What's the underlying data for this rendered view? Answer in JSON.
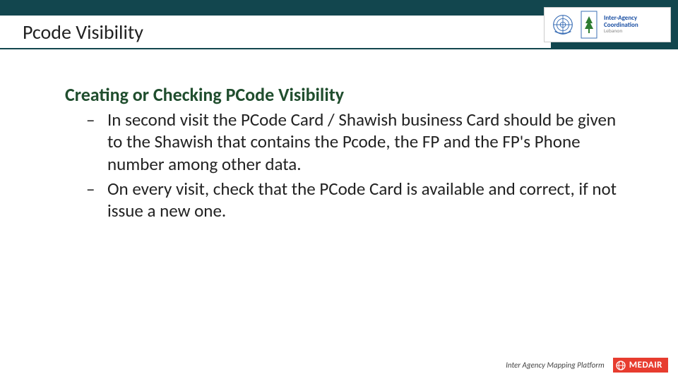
{
  "header": {
    "title": "Pcode Visibility",
    "logo": {
      "text_line1": "Inter-Agency",
      "text_line2": "Coordination",
      "text_line3": "Lebanon"
    }
  },
  "content": {
    "subtitle": "Creating  or Checking PCode Visibility",
    "bullets": [
      "In second visit the PCode Card / Shawish business Card should be given to the Shawish that contains the Pcode, the FP and the FP's Phone number among other data.",
      "On every visit, check that the PCode Card is available and correct, if not issue a new one."
    ]
  },
  "footer": {
    "caption": "Inter Agency Mapping Platform",
    "brand": "MEDAIR"
  },
  "colors": {
    "header_bg": "#12464e",
    "subtitle": "#204e2e",
    "brand_bg": "#e73c2f"
  }
}
